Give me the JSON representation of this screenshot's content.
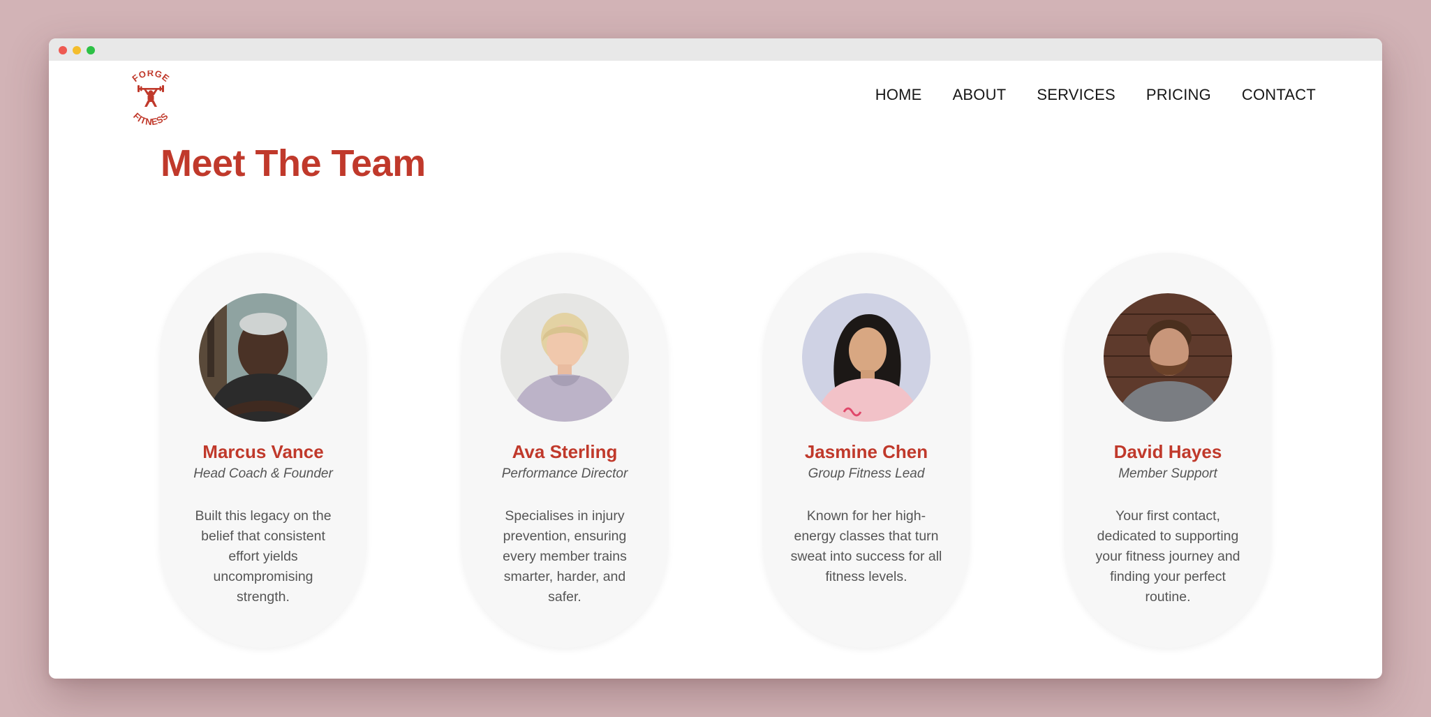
{
  "logo": {
    "top_text": "FORGE",
    "bottom_text": "FITNESS"
  },
  "nav": {
    "items": [
      "HOME",
      "ABOUT",
      "SERVICES",
      "PRICING",
      "CONTACT"
    ]
  },
  "page": {
    "title": "Meet The Team"
  },
  "team": [
    {
      "name": "Marcus Vance",
      "role": "Head Coach & Founder",
      "bio": "Built this legacy on the belief that consistent effort yields uncompromising strength."
    },
    {
      "name": "Ava Sterling",
      "role": "Performance Director",
      "bio": "Specialises in injury prevention, ensuring every member trains smarter, harder, and safer."
    },
    {
      "name": "Jasmine Chen",
      "role": "Group Fitness Lead",
      "bio": "Known for her high-energy classes that turn sweat into success for all fitness levels."
    },
    {
      "name": "David Hayes",
      "role": "Member Support",
      "bio": "Your first contact, dedicated to supporting your fitness journey and finding your perfect routine."
    }
  ],
  "colors": {
    "accent": "#c0392b",
    "page_background": "#d2b3b6",
    "card_background": "#f7f7f7"
  }
}
